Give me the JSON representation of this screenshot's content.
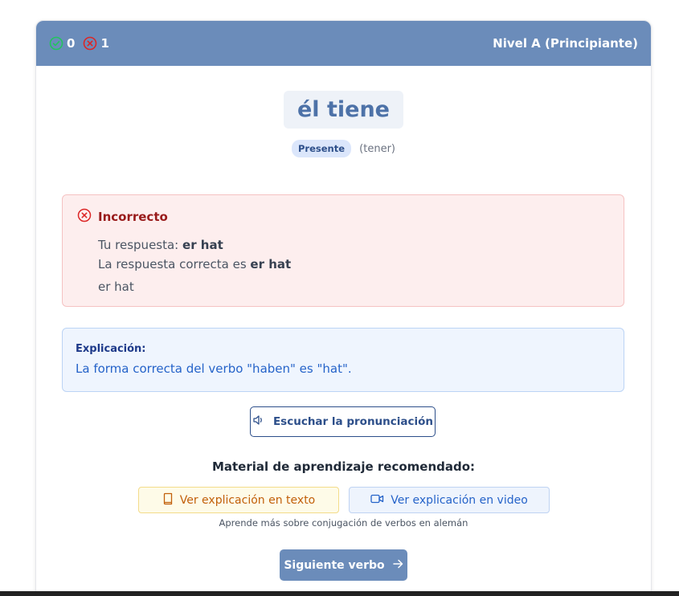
{
  "header": {
    "correct_count": "0",
    "incorrect_count": "1",
    "level": "Nivel A (Principiante)"
  },
  "verb": {
    "prompt": "él tiene",
    "tense_badge": "Presente",
    "infinitive": "(tener)"
  },
  "feedback": {
    "title": "Incorrecto",
    "your_answer_label": "Tu respuesta: ",
    "your_answer": "er hat",
    "correct_label": "La respuesta correcta es ",
    "correct_answer": "er hat",
    "extra_line": "er hat"
  },
  "explanation": {
    "title": "Explicación:",
    "text": "La forma correcta del verbo \"haben\" es \"hat\"."
  },
  "actions": {
    "listen_label": "Escuchar la pronunciación",
    "material_title": "Material de aprendizaje recomendado:",
    "text_label": "Ver explicación en texto",
    "video_label": "Ver explicación en video",
    "learn_note": "Aprende más sobre conjugación de verbos en alemán",
    "next_label": "Siguiente verbo"
  },
  "icons": {
    "correct": "check-circle-icon",
    "incorrect": "x-circle-icon",
    "speaker": "volume-icon",
    "book": "book-icon",
    "video": "video-icon",
    "arrow": "arrow-right-icon"
  },
  "colors": {
    "header_bg": "#6b8cba",
    "correct_green": "#22c55e",
    "incorrect_red": "#dc2626",
    "verb_text": "#4d72a8",
    "error_bg": "#fdeeee",
    "explain_bg": "#eff5fe",
    "text_button": "#c2600a",
    "video_button": "#2563c9"
  }
}
